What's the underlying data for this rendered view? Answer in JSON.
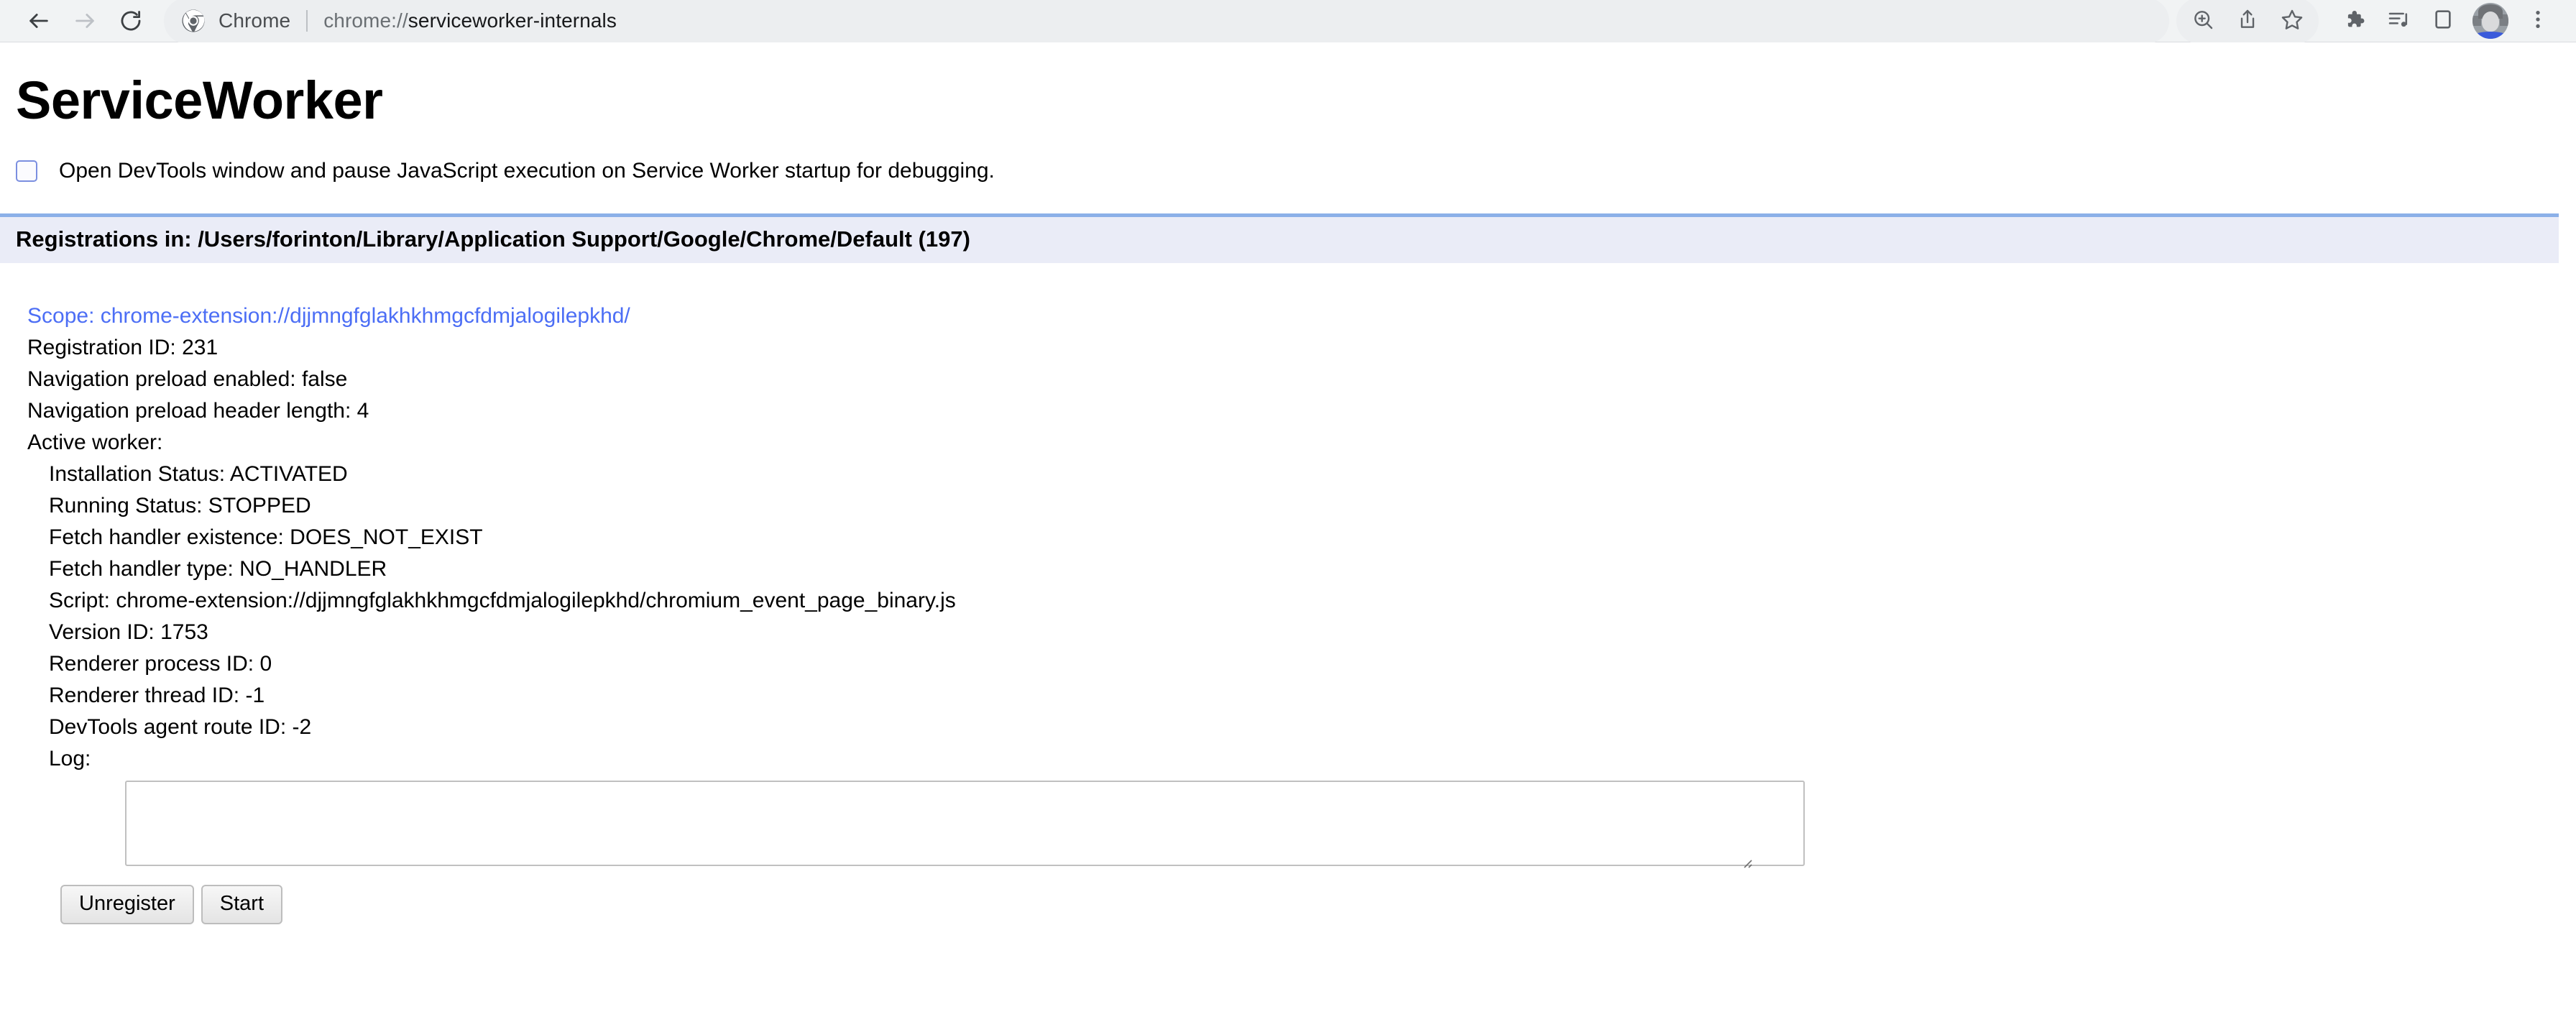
{
  "browser": {
    "nav": {
      "back": "back-arrow",
      "forward": "forward-arrow",
      "reload": "reload"
    },
    "omnibox": {
      "chip_label": "Chrome",
      "url_scheme": "chrome://",
      "url_host": "serviceworker-internals",
      "full_url": "chrome://serviceworker-internals"
    },
    "toolbar_icons": [
      "zoom-in-icon",
      "share-icon",
      "bookmark-star-icon",
      "extensions-puzzle-icon",
      "media-playlist-icon",
      "side-panel-icon",
      "profile-avatar",
      "three-dot-menu-icon"
    ]
  },
  "page": {
    "title": "ServiceWorker",
    "devtools_checkbox": {
      "label": "Open DevTools window and pause JavaScript execution on Service Worker startup for debugging.",
      "checked": false
    },
    "registrations_header": "Registrations in: /Users/forinton/Library/Application Support/Google/Chrome/Default (197)",
    "registration": {
      "scope": "Scope: chrome-extension://djjmngfglakhkhmgcfdmjalogilepkhd/",
      "registration_id": "Registration ID: 231",
      "nav_preload_enabled": "Navigation preload enabled: false",
      "nav_preload_header_length": "Navigation preload header length: 4",
      "active_worker_label": "Active worker:",
      "worker": {
        "installation_status": "Installation Status: ACTIVATED",
        "running_status": "Running Status: STOPPED",
        "fetch_handler_existence": "Fetch handler existence: DOES_NOT_EXIST",
        "fetch_handler_type": "Fetch handler type: NO_HANDLER",
        "script": "Script: chrome-extension://djjmngfglakhkhmgcfdmjalogilepkhd/chromium_event_page_binary.js",
        "version_id": "Version ID: 1753",
        "renderer_process_id": "Renderer process ID: 0",
        "renderer_thread_id": "Renderer thread ID: -1",
        "devtools_agent_route_id": "DevTools agent route ID: -2",
        "log_label": "Log:",
        "log_value": ""
      },
      "buttons": {
        "unregister": "Unregister",
        "start": "Start"
      }
    }
  },
  "colors": {
    "toolbar_bg": "#f1f3f4",
    "omnibox_bg": "#eceef0",
    "link_blue": "#4c6ef5",
    "reg_header_bg": "#eaecf7",
    "reg_header_border": "#8bb0e8",
    "checkbox_border": "#7b8fe0"
  }
}
